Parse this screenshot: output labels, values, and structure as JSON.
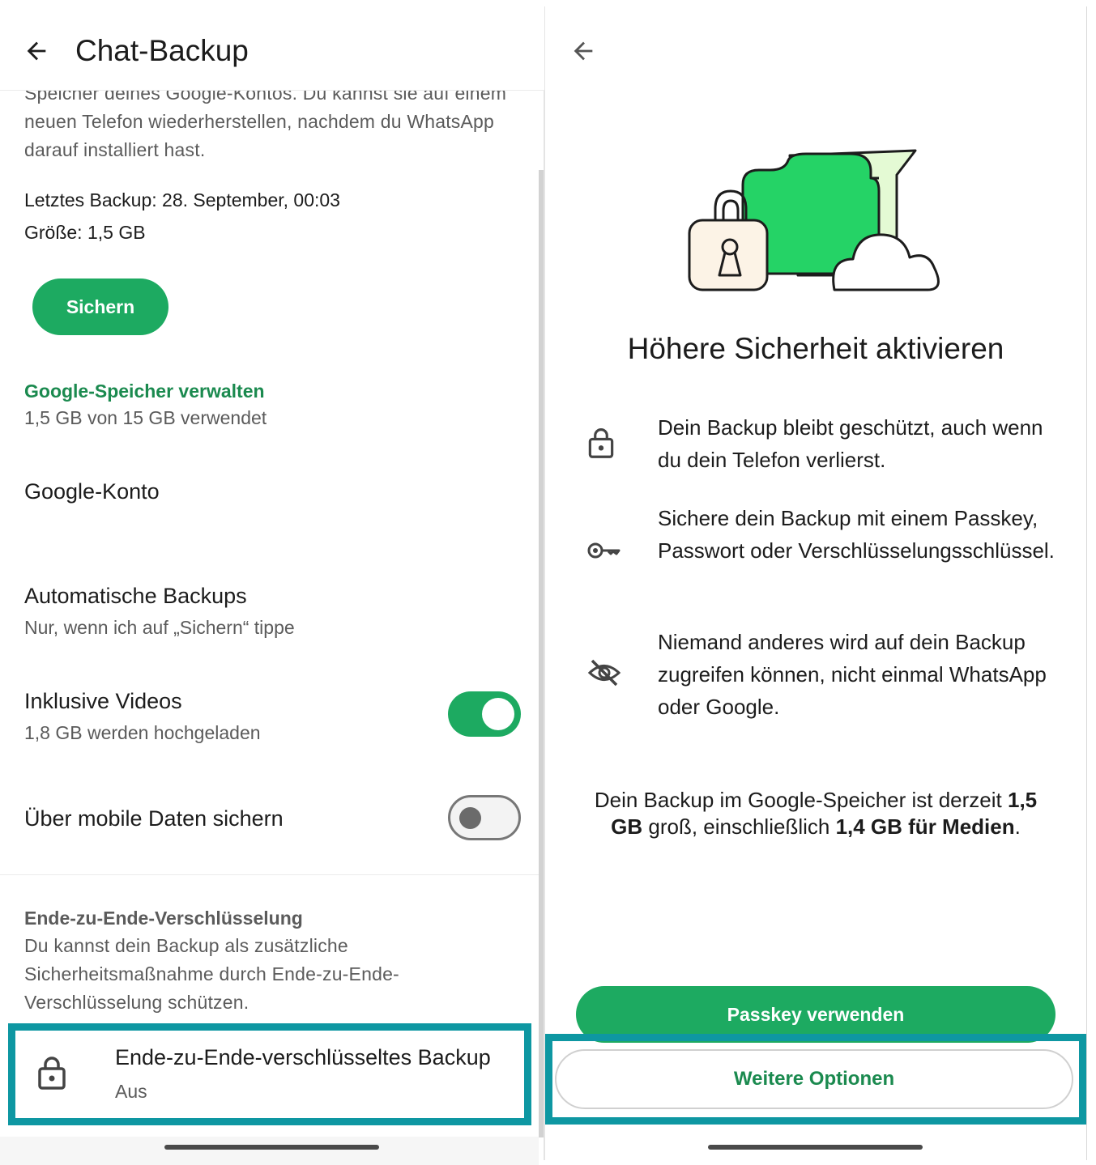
{
  "left": {
    "appbar": {
      "title": "Chat-Backup"
    },
    "description": "Speicher deines Google-Kontos. Du kannst sie auf einem neuen Telefon wiederherstellen, nachdem du WhatsApp darauf installiert hast.",
    "last_backup": "Letztes Backup: 28. September, 00:03",
    "size": "Größe: 1,5 GB",
    "backup_button": "Sichern",
    "storage": {
      "title": "Google-Speicher verwalten",
      "usage": "1,5 GB von 15 GB verwendet"
    },
    "google_account": {
      "title": "Google-Konto"
    },
    "auto_backups": {
      "title": "Automatische Backups",
      "value": "Nur, wenn ich auf „Sichern“ tippe"
    },
    "include_videos": {
      "title": "Inklusive Videos",
      "subtitle": "1,8 GB werden hochgeladen",
      "enabled": true
    },
    "mobile_data": {
      "title": "Über mobile Daten sichern",
      "enabled": false
    },
    "e2e_section": {
      "heading": "Ende-zu-Ende-Verschlüsselung",
      "description": "Du kannst dein Backup als zusätzliche Sicherheitsmaßnahme durch Ende-zu-Ende-Verschlüsselung schützen."
    },
    "e2e_item": {
      "title": "Ende-zu-Ende-verschlüsseltes Backup",
      "status": "Aus"
    }
  },
  "right": {
    "title": "Höhere Sicherheit aktivieren",
    "features": [
      {
        "icon": "lock-icon",
        "text": "Dein Backup bleibt geschützt, auch wenn du dein Telefon verlierst."
      },
      {
        "icon": "key-icon",
        "text": "Sichere dein Backup mit einem Passkey, Passwort oder Verschlüsselungsschlüssel."
      },
      {
        "icon": "eye-off-icon",
        "text": "Niemand anderes wird auf dein Backup zugreifen können, nicht einmal WhatsApp oder Google."
      }
    ],
    "info": {
      "part1": "Dein Backup im Google-Speicher ist derzeit ",
      "size": "1,5 GB",
      "part2": " groß, einschließlich ",
      "media": "1,4 GB für Medien",
      "part3": "."
    },
    "primary_button": "Passkey verwenden",
    "secondary_button": "Weitere Optionen"
  },
  "colors": {
    "accent": "#1daa61",
    "link": "#1b8a4f",
    "highlight": "#0e97a2"
  }
}
